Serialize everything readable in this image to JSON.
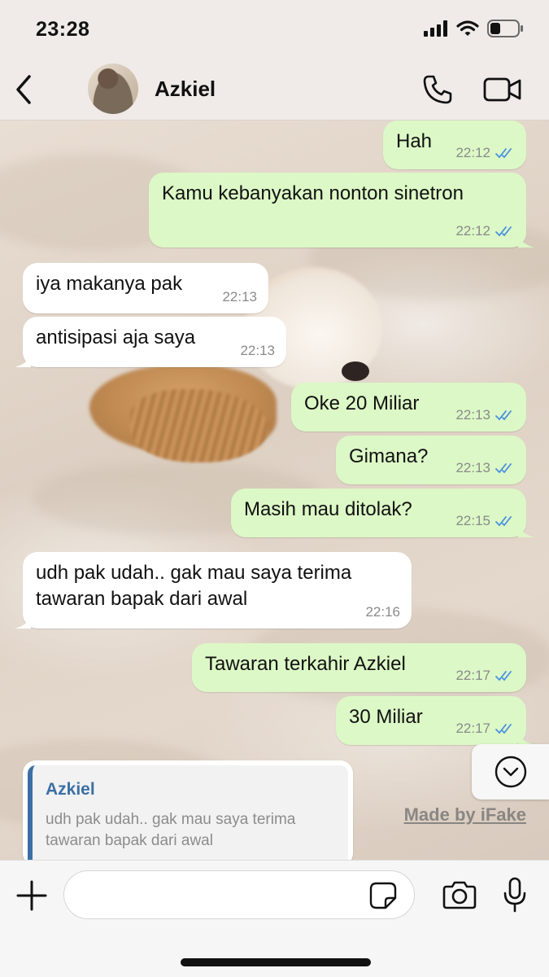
{
  "status_bar": {
    "time": "23:28"
  },
  "header": {
    "contact_name": "Azkiel"
  },
  "messages": [
    {
      "direction": "out",
      "text": "Hah",
      "time": "22:12",
      "read": true
    },
    {
      "direction": "out",
      "text": "Kamu kebanyakan nonton sinetron",
      "time": "22:12",
      "read": true
    },
    {
      "direction": "in",
      "text": "iya makanya pak",
      "time": "22:13"
    },
    {
      "direction": "in",
      "text": "antisipasi aja saya",
      "time": "22:13"
    },
    {
      "direction": "out",
      "text": "Oke 20 Miliar",
      "time": "22:13",
      "read": true
    },
    {
      "direction": "out",
      "text": "Gimana?",
      "time": "22:13",
      "read": true
    },
    {
      "direction": "out",
      "text": "Masih mau ditolak?",
      "time": "22:15",
      "read": true
    },
    {
      "direction": "in",
      "text": "udh pak udah.. gak mau saya terima\ntawaran bapak dari awal",
      "time": "22:16"
    },
    {
      "direction": "out",
      "text": "Tawaran terkahir Azkiel",
      "time": "22:17",
      "read": true
    },
    {
      "direction": "out",
      "text": "30 Miliar",
      "time": "22:17",
      "read": true
    }
  ],
  "reply_preview": {
    "name": "Azkiel",
    "text": "udh pak udah.. gak mau saya terima\ntawaran bapak dari awal"
  },
  "watermark": "Made by iFake",
  "input": {
    "placeholder": ""
  },
  "colors": {
    "outgoing_bubble": "#dcf8c6",
    "incoming_bubble": "#ffffff",
    "read_ticks": "#4a90e2",
    "reply_accent": "#3b6fa6"
  },
  "icons": [
    "back-chevron",
    "phone",
    "video-camera",
    "chevron-down-circle",
    "plus",
    "sticker",
    "camera",
    "microphone",
    "signal-bars",
    "wifi",
    "battery"
  ]
}
